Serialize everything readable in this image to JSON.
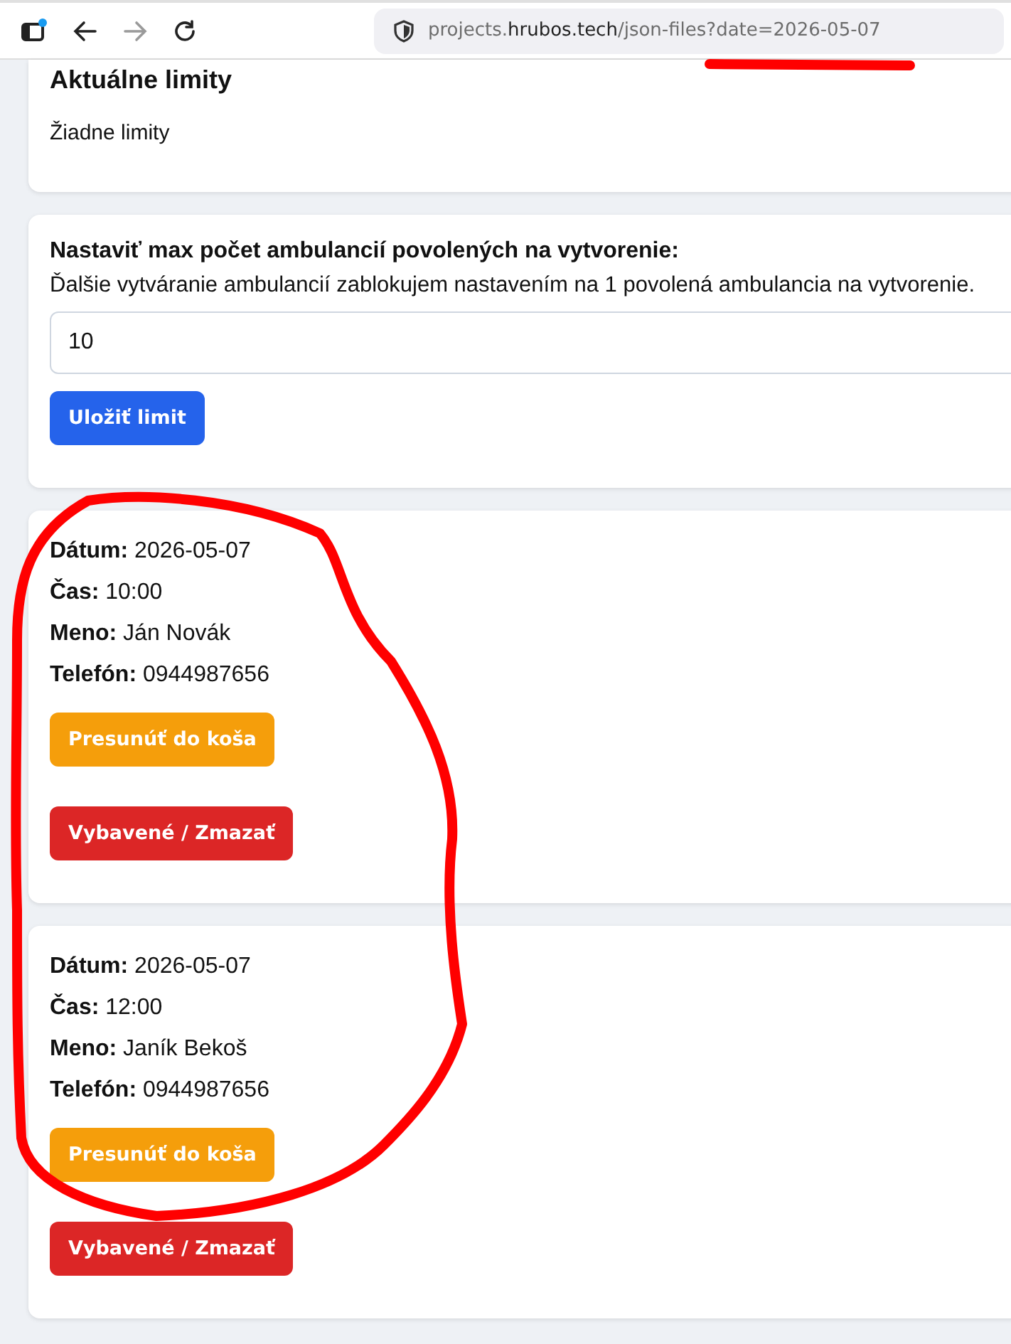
{
  "browser": {
    "nav": [
      {
        "kind": "back",
        "disabled": false
      },
      {
        "kind": "forward",
        "disabled": true
      },
      {
        "kind": "reload",
        "disabled": false
      }
    ],
    "url": {
      "subdomain": "projects.",
      "domain": "hrubos.tech",
      "path": "/json-files?date=2026-05-07"
    }
  },
  "limits_card": {
    "title": "Aktuálne limity",
    "text": "Žiadne limity"
  },
  "limit_form": {
    "label": "Nastaviť max počet ambulancií povolených na vytvorenie:",
    "hint": "Ďalšie vytváranie ambulancií zablokujem nastavením na 1 povolená ambulancia na vytvorenie.",
    "value": "10",
    "button": "Uložiť limit"
  },
  "bookings": [
    {
      "fields": [
        {
          "label": "Dátum:",
          "value": "2026-05-07"
        },
        {
          "label": "Čas:",
          "value": "10:00"
        },
        {
          "label": "Meno:",
          "value": "Ján Novák"
        },
        {
          "label": "Telefón:",
          "value": "0944987656"
        }
      ],
      "buttons": [
        {
          "kind": "warning",
          "label": "Presunúť do koša"
        },
        {
          "kind": "danger",
          "label": "Vybavené / Zmazať"
        }
      ]
    },
    {
      "fields": [
        {
          "label": "Dátum:",
          "value": "2026-05-07"
        },
        {
          "label": "Čas:",
          "value": "12:00"
        },
        {
          "label": "Meno:",
          "value": "Janík Bekoš"
        },
        {
          "label": "Telefón:",
          "value": "0944987656"
        }
      ],
      "buttons": [
        {
          "kind": "warning",
          "label": "Presunúť do koša"
        },
        {
          "kind": "danger",
          "label": "Vybavené / Zmazať"
        }
      ]
    }
  ]
}
